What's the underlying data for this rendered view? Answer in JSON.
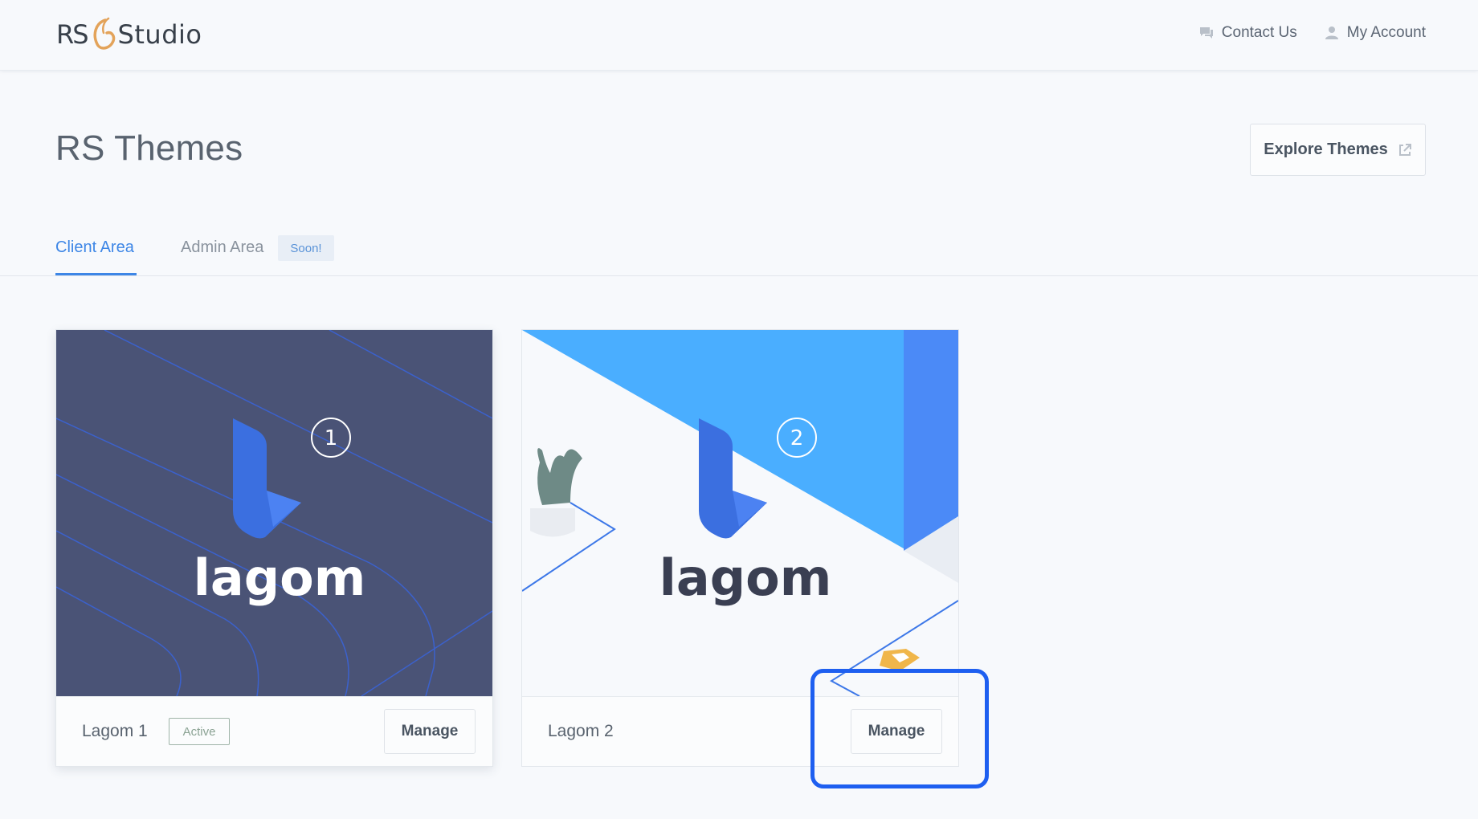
{
  "header": {
    "logo_left": "RS",
    "logo_right": "Studio",
    "nav": [
      {
        "label": "Contact Us",
        "icon": "chat-icon"
      },
      {
        "label": "My Account",
        "icon": "user-icon"
      }
    ]
  },
  "page": {
    "title": "RS Themes",
    "explore_label": "Explore Themes"
  },
  "tabs": {
    "client": "Client Area",
    "admin": "Admin Area",
    "admin_badge": "Soon!"
  },
  "cards": [
    {
      "name": "Lagom 1",
      "badge": "Active",
      "number": "1",
      "logo_text": "lagom",
      "manage_label": "Manage"
    },
    {
      "name": "Lagom 2",
      "number": "2",
      "logo_text": "lagom",
      "manage_label": "Manage"
    }
  ],
  "colors": {
    "accent": "#3d86e6",
    "card1_bg": "#4a5376",
    "card2_blue": "#4aaeff",
    "highlight": "#1e5ff0"
  }
}
